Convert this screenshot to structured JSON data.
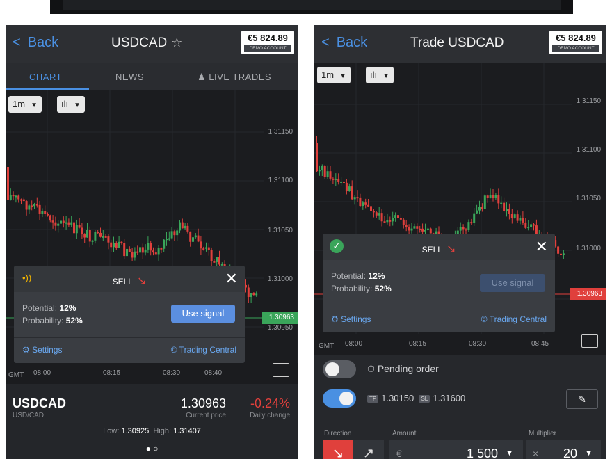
{
  "left": {
    "back_label": "Back",
    "title": "USDCAD",
    "star": "☆",
    "balance": "€5 824.89",
    "account": "DEMO ACCOUNT",
    "tabs": [
      "CHART",
      "NEWS",
      "LIVE TRADES"
    ],
    "timeframe": "1m",
    "chart_type_icon": "candlestick-icon",
    "y_ticks": [
      "1.31150",
      "1.31100",
      "1.31050",
      "1.31000",
      "1.30950"
    ],
    "current_tag": "1.30963",
    "time_ticks": [
      "08:00",
      "08:15",
      "08:30",
      "08:40"
    ],
    "gmt": "GMT",
    "signal": {
      "action": "SELL",
      "potential_label": "Potential:",
      "potential_value": "12%",
      "probability_label": "Probability:",
      "probability_value": "52%",
      "button": "Use signal",
      "settings": "Settings",
      "provider": "© Trading Central"
    },
    "quote": {
      "symbol": "USDCAD",
      "subtitle": "USD/CAD",
      "price": "1.30963",
      "price_label": "Current price",
      "change": "-0.24%",
      "change_label": "Daily change",
      "low_label": "Low:",
      "low": "1.30925",
      "high_label": "High:",
      "high": "1.31407",
      "pager": "● ○"
    }
  },
  "right": {
    "back_label": "Back",
    "title": "Trade USDCAD",
    "balance": "€5 824.89",
    "account": "DEMO ACCOUNT",
    "timeframe": "1m",
    "y_ticks": [
      "1.31150",
      "1.31100",
      "1.31050",
      "1.31000"
    ],
    "current_tag": "1.30963",
    "time_ticks": [
      "08:00",
      "08:15",
      "08:30",
      "08:45"
    ],
    "gmt": "GMT",
    "signal": {
      "action": "SELL",
      "potential_label": "Potential:",
      "potential_value": "12%",
      "probability_label": "Probability:",
      "probability_value": "52%",
      "button": "Use signal",
      "settings": "Settings",
      "provider": "© Trading Central"
    },
    "pending_order": "Pending order",
    "tp_chip": "TP",
    "tp_value": "1.30150",
    "sl_chip": "SL",
    "sl_value": "1.31600",
    "direction_label": "Direction",
    "amount_label": "Amount",
    "amount_currency": "€",
    "amount_value": "1 500",
    "multiplier_label": "Multiplier",
    "multiplier_symbol": "×",
    "multiplier_value": "20"
  },
  "colors": {
    "accent": "#4a90e2",
    "up": "#3aa55a",
    "down": "#e0403c",
    "bg": "#26282c"
  }
}
